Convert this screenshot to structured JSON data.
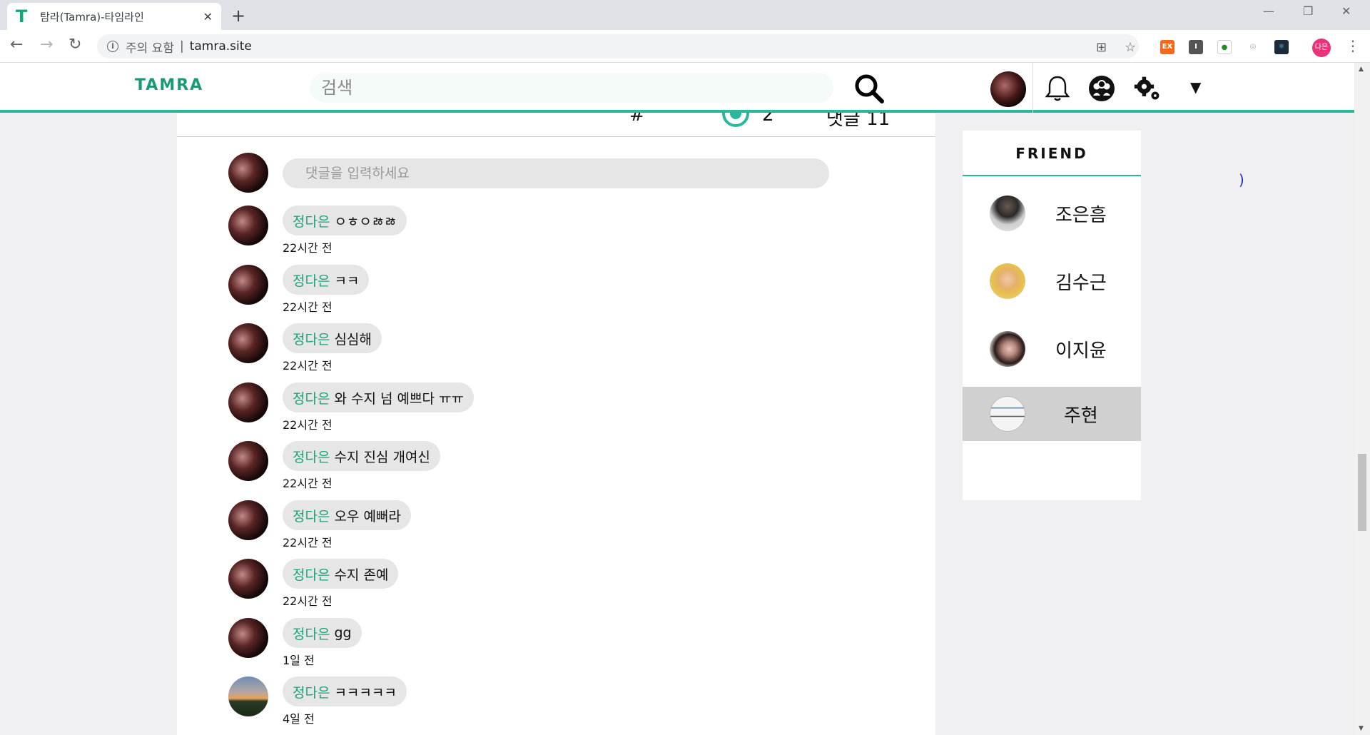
{
  "browser": {
    "tab_title": "탐라(Tamra)-타임라인",
    "tab_favicon": "T",
    "security_warning": "주의 요함",
    "url": "tamra.site",
    "profile_label": "다은",
    "ext_ex_label": "EX",
    "ext_i_label": "I"
  },
  "site": {
    "logo": "TAMRA",
    "search_placeholder": "검색"
  },
  "comment_box": {
    "placeholder": "댓글을 입력하세요"
  },
  "stats": {
    "hash": "#",
    "count": "2",
    "comments": "댓글 11"
  },
  "comments": [
    {
      "author": "정다은",
      "text": "ㅇㅎㅇㅀㅀ",
      "time": "22시간 전",
      "avatar": "photo"
    },
    {
      "author": "정다은",
      "text": "ㅋㅋ",
      "time": "22시간 전",
      "avatar": "photo"
    },
    {
      "author": "정다은",
      "text": "심심해",
      "time": "22시간 전",
      "avatar": "photo"
    },
    {
      "author": "정다은",
      "text": "와 수지 넘 예쁘다 ㅠㅠ",
      "time": "22시간 전",
      "avatar": "photo"
    },
    {
      "author": "정다은",
      "text": "수지  진심 개여신",
      "time": "22시간 전",
      "avatar": "photo"
    },
    {
      "author": "정다은",
      "text": "오우 예뻐라",
      "time": "22시간 전",
      "avatar": "photo"
    },
    {
      "author": "정다은",
      "text": "수지 존예",
      "time": "22시간 전",
      "avatar": "photo"
    },
    {
      "author": "정다은",
      "text": "gg",
      "time": "1일 전",
      "avatar": "photo"
    },
    {
      "author": "정다은",
      "text": "ㅋㅋㅋㅋㅋ",
      "time": "4일 전",
      "avatar": "sunset"
    }
  ],
  "friends": {
    "title": "FRIEND",
    "items": [
      {
        "name": "조은흠",
        "active": false
      },
      {
        "name": "김수근",
        "active": false
      },
      {
        "name": "이지윤",
        "active": false
      },
      {
        "name": "주현",
        "active": true
      }
    ]
  },
  "stray_mark": ")",
  "colors": {
    "brand": "#189a77",
    "accent": "#2ab89d",
    "bubble": "#e6e6e6"
  }
}
